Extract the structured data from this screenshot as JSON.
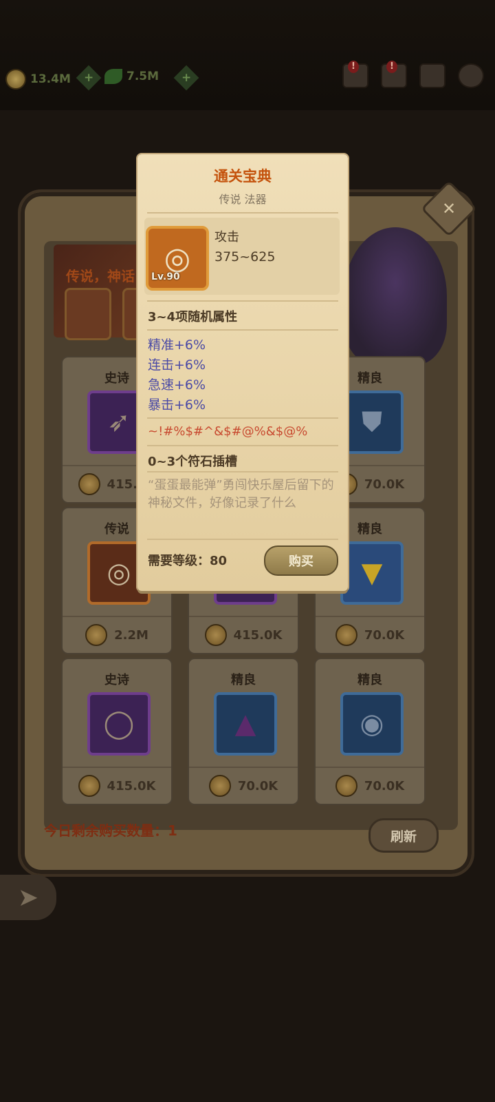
{
  "topbar": {
    "gold": "13.4M",
    "gems": "7.5M",
    "icons": [
      "rank-alert-icon",
      "chat-alert-icon",
      "mail-icon",
      "settings-icon"
    ]
  },
  "shop": {
    "banner_text": "传说，神话",
    "remaining_label": "今日剩余购买数量：1",
    "refresh_label": "刷新",
    "close_symbol": "✕",
    "items": [
      {
        "rarity": "史诗",
        "price": "415.0K",
        "icon": "arrows-icon"
      },
      {
        "rarity": "精良",
        "price": "70.0K",
        "icon": "shield-icon"
      },
      {
        "rarity": "传说",
        "price": "2.2M",
        "icon": "scroll-icon"
      },
      {
        "rarity": "",
        "price": "415.0K",
        "icon": "item-icon"
      },
      {
        "rarity": "精良",
        "price": "70.0K",
        "icon": "cape-icon"
      },
      {
        "rarity": "史诗",
        "price": "415.0K",
        "icon": "ring-icon"
      },
      {
        "rarity": "精良",
        "price": "70.0K",
        "icon": "hood-icon"
      },
      {
        "rarity": "精良",
        "price": "70.0K",
        "icon": "eye-ring-icon"
      }
    ]
  },
  "popup": {
    "title": "通关宝典",
    "subtitle": "传说 法器",
    "level_badge": "Lv.90",
    "stat_label": "攻击",
    "stat_value": "375~625",
    "random_attrs": "3~4项随机属性",
    "attrs": [
      "精准+6%",
      "连击+6%",
      "急速+6%",
      "暴击+6%"
    ],
    "glitch_text": "~!#%$#^&$#@%&$@%",
    "rune_slots": "0~3个符石插槽",
    "description": "“蛋蛋最能弹”勇闯快乐屋后留下的神秘文件，好像记录了什么",
    "required_level": "需要等级：80",
    "buy_label": "购买"
  },
  "colors": {
    "accent_title": "#c4520c",
    "attr_blue": "#4a4aa6",
    "glitch_red": "#c84a30"
  }
}
